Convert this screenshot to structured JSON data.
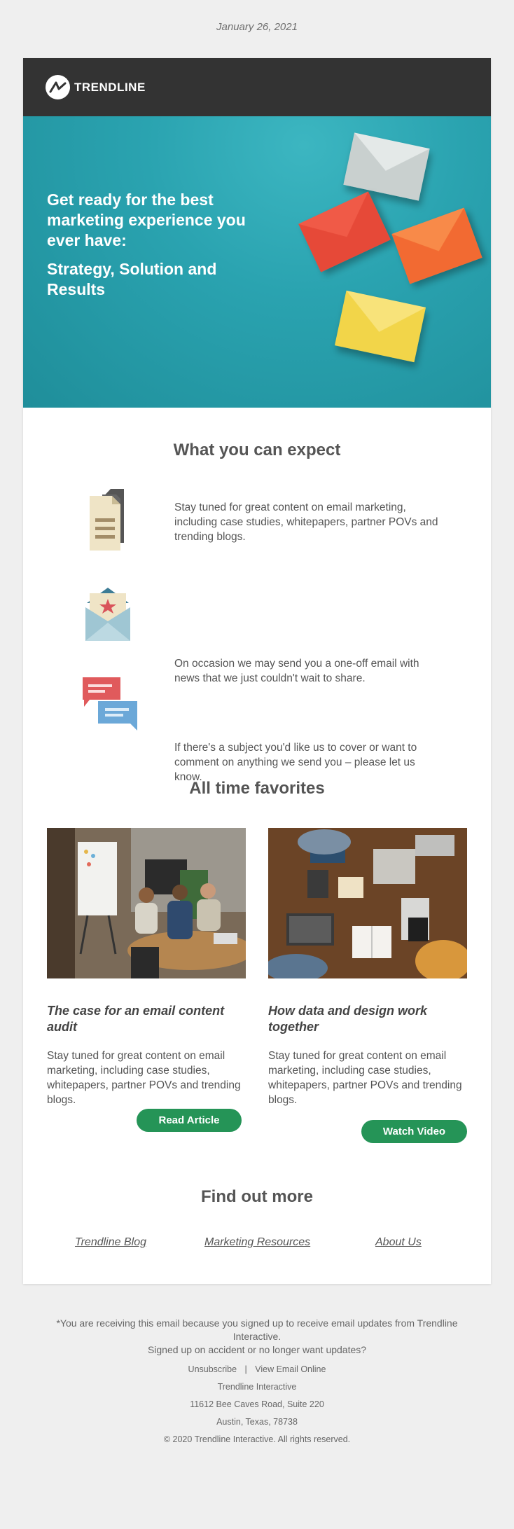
{
  "date": "January 26, 2021",
  "brand": {
    "name": "TRENDLINE",
    "icon": "trendline-logo-icon"
  },
  "hero": {
    "headline": "Get ready for the best marketing experience you ever have:",
    "subheadline": "Strategy, Solution and Results",
    "background": "#2aa3b0"
  },
  "expect": {
    "title": "What you can expect",
    "items": [
      {
        "icon": "document-icon",
        "text": "Stay tuned for great content on email marketing, including case studies, whitepapers, partner POVs and trending blogs."
      },
      {
        "icon": "envelope-star-icon",
        "text": "On occasion we may send you a one-off email with news that we just couldn't wait to share."
      },
      {
        "icon": "chat-bubbles-icon",
        "text": "If there's a subject you'd like us to cover or want to comment on anything we send you – please let us know."
      }
    ]
  },
  "favorites": {
    "title": "All time favorites",
    "items": [
      {
        "title": "The case for an email content audit",
        "text": "Stay tuned for great content on email marketing, including case studies, whitepapers, partner POVs and trending blogs.",
        "button": "Read Article"
      },
      {
        "title": "How data and design work together",
        "text": "Stay tuned for great content on email marketing, including case studies, whitepapers, partner POVs and trending blogs.",
        "button": "Watch Video"
      }
    ]
  },
  "find_more": {
    "title": "Find out more",
    "links": [
      "Trendline Blog",
      "Marketing Resources",
      "About Us"
    ]
  },
  "footer": {
    "notice_line1": "*You are receiving this email because you signed up to receive email updates from Trendline Interactive.",
    "notice_line2": "Signed up on accident or no longer want updates?",
    "unsubscribe": "Unsubscribe",
    "separator": "|",
    "view_online": "View Email Online",
    "company": "Trendline Interactive",
    "address1": "11612 Bee Caves Road, Suite 220",
    "address2": "Austin, Texas, 78738",
    "copyright": "© 2020 Trendline Interactive. All rights reserved."
  },
  "colors": {
    "accent_button": "#259457",
    "header_bar": "#333333",
    "page_bg": "#efefef"
  }
}
